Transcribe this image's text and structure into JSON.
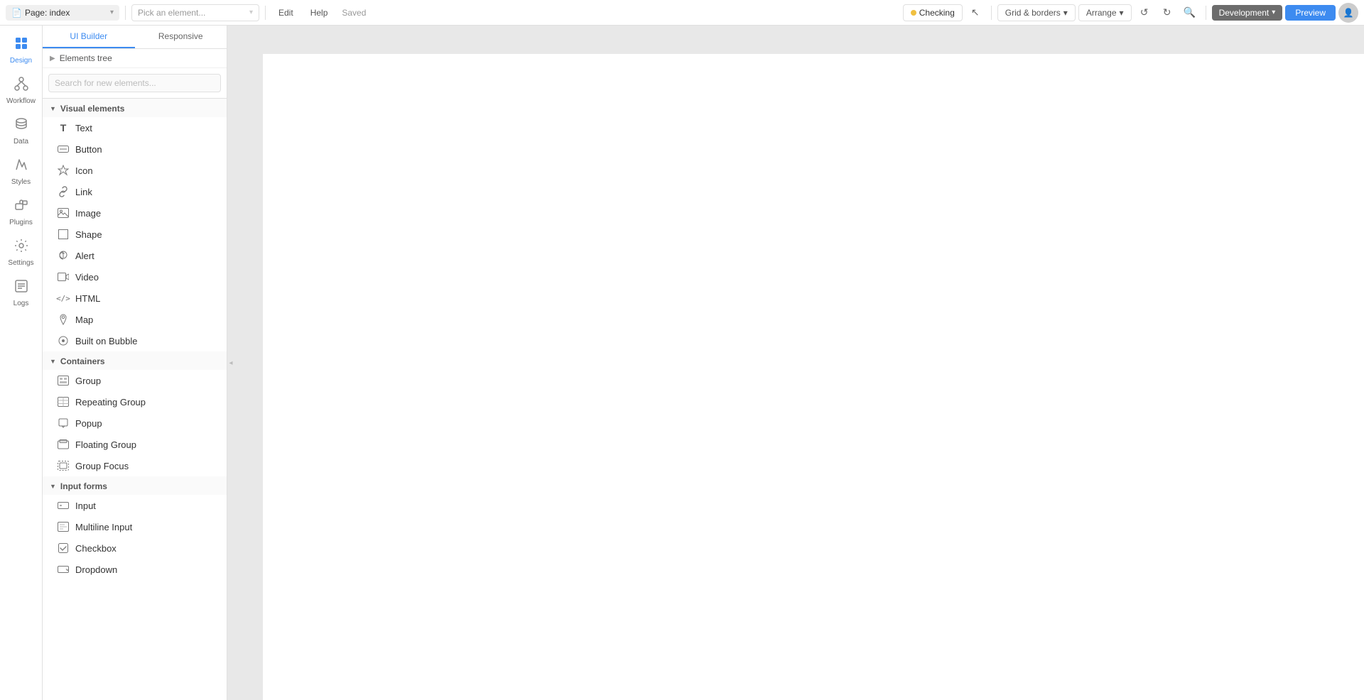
{
  "topbar": {
    "page_icon": "📄",
    "page_label": "Page: index",
    "page_chevron": "▾",
    "pick_placeholder": "Pick an element...",
    "pick_chevron": "▾",
    "edit_label": "Edit",
    "help_label": "Help",
    "saved_label": "Saved",
    "checking_label": "Checking",
    "grid_borders_label": "Grid & borders",
    "grid_borders_chevron": "▾",
    "arrange_label": "Arrange",
    "arrange_chevron": "▾",
    "undo_icon": "↺",
    "redo_icon": "↻",
    "search_icon": "🔍",
    "development_label": "Development",
    "development_chevron": "▾",
    "preview_label": "Preview"
  },
  "icon_sidebar": {
    "items": [
      {
        "id": "design",
        "icon": "⬡",
        "label": "Design",
        "active": true
      },
      {
        "id": "workflow",
        "icon": "⚡",
        "label": "Workflow",
        "active": false
      },
      {
        "id": "data",
        "icon": "🗄",
        "label": "Data",
        "active": false
      },
      {
        "id": "styles",
        "icon": "✏",
        "label": "Styles",
        "active": false
      },
      {
        "id": "plugins",
        "icon": "🧩",
        "label": "Plugins",
        "active": false
      },
      {
        "id": "settings",
        "icon": "⚙",
        "label": "Settings",
        "active": false
      },
      {
        "id": "logs",
        "icon": "📋",
        "label": "Logs",
        "active": false
      }
    ]
  },
  "panel": {
    "tabs": [
      {
        "id": "ui-builder",
        "label": "UI Builder",
        "active": true
      },
      {
        "id": "responsive",
        "label": "Responsive",
        "active": false
      }
    ],
    "search_placeholder": "Search for new elements...",
    "elements_tree_label": "Elements tree",
    "sections": [
      {
        "id": "visual",
        "label": "Visual elements",
        "expanded": true,
        "items": [
          {
            "id": "text",
            "label": "Text",
            "icon": "T"
          },
          {
            "id": "button",
            "label": "Button",
            "icon": "BTN"
          },
          {
            "id": "icon",
            "label": "Icon",
            "icon": "◈"
          },
          {
            "id": "link",
            "label": "Link",
            "icon": "🔗"
          },
          {
            "id": "image",
            "label": "Image",
            "icon": "🖼"
          },
          {
            "id": "shape",
            "label": "Shape",
            "icon": "□"
          },
          {
            "id": "alert",
            "label": "Alert",
            "icon": "🔔"
          },
          {
            "id": "video",
            "label": "Video",
            "icon": "▶"
          },
          {
            "id": "html",
            "label": "HTML",
            "icon": "</>"
          },
          {
            "id": "map",
            "label": "Map",
            "icon": "📍"
          },
          {
            "id": "built-on-bubble",
            "label": "Built on Bubble",
            "icon": "◉"
          }
        ]
      },
      {
        "id": "containers",
        "label": "Containers",
        "expanded": true,
        "items": [
          {
            "id": "group",
            "label": "Group",
            "icon": "▣"
          },
          {
            "id": "repeating-group",
            "label": "Repeating Group",
            "icon": "⊞"
          },
          {
            "id": "popup",
            "label": "Popup",
            "icon": "⊡"
          },
          {
            "id": "floating-group",
            "label": "Floating Group",
            "icon": "⊟"
          },
          {
            "id": "group-focus",
            "label": "Group Focus",
            "icon": "⊠"
          }
        ]
      },
      {
        "id": "input-forms",
        "label": "Input forms",
        "expanded": true,
        "items": [
          {
            "id": "input",
            "label": "Input",
            "icon": "⊡"
          },
          {
            "id": "multiline-input",
            "label": "Multiline Input",
            "icon": "⊞"
          },
          {
            "id": "checkbox",
            "label": "Checkbox",
            "icon": "☑"
          },
          {
            "id": "dropdown",
            "label": "Dropdown",
            "icon": "▽"
          }
        ]
      }
    ]
  },
  "canvas": {
    "background": "#e8e8e8"
  }
}
